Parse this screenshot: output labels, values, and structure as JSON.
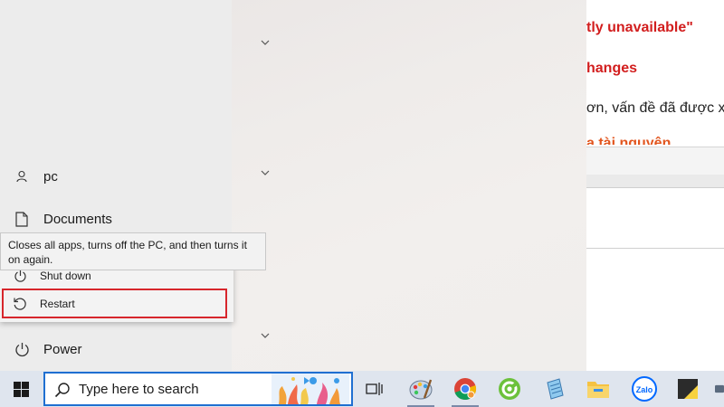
{
  "background_page": {
    "line1": "tly unavailable\"",
    "line2": "hanges",
    "line3": "ơn, vấn đề đã được x",
    "line4": "a tài nguyên"
  },
  "start_menu": {
    "user": "pc",
    "documents": "Documents",
    "power": "Power"
  },
  "power_menu": {
    "shutdown": "Shut down",
    "restart": "Restart"
  },
  "tooltip": {
    "text": "Closes all apps, turns off the PC, and then turns it on again."
  },
  "taskbar": {
    "search_placeholder": "Type here to search",
    "apps": [
      "windows-start",
      "task-view",
      "paint",
      "chrome",
      "coc-coc",
      "notepad",
      "file-explorer",
      "zalo",
      "sticky-notes"
    ]
  },
  "colors": {
    "highlight_border": "#d7262c",
    "search_border": "#1f6fd1",
    "heading_red": "#d21e1e",
    "heading_orange": "#e2561f"
  }
}
